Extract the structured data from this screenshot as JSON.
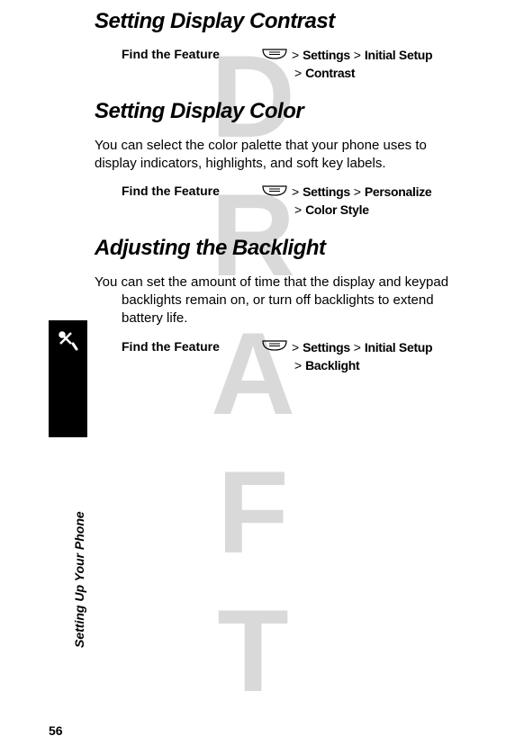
{
  "watermark": "DRAFT",
  "page_number": "56",
  "sidebar_label": "Setting Up Your Phone",
  "sections": {
    "contrast": {
      "title": "Setting Display Contrast",
      "find_label": "Find the Feature",
      "path1_gt1": "> ",
      "path1_item1": "Settings",
      "path1_gt2": " > ",
      "path1_item2": "Initial Setup",
      "path2_gt": "> ",
      "path2_item": "Contrast"
    },
    "color": {
      "title": "Setting Display Color",
      "body": "You can select the color palette that your phone uses to display indicators, highlights, and soft key labels.",
      "find_label": "Find the Feature",
      "path1_gt1": "> ",
      "path1_item1": "Settings",
      "path1_gt2": " > ",
      "path1_item2": "Personalize",
      "path2_gt": "> ",
      "path2_item": "Color Style"
    },
    "backlight": {
      "title": "Adjusting the Backlight",
      "body": "You can set the amount of time that the display and keypad backlights remain on, or turn off backlights to extend battery life.",
      "find_label": "Find the Feature",
      "path1_gt1": "> ",
      "path1_item1": "Settings",
      "path1_gt2": " > ",
      "path1_item2": "Initial Setup",
      "path2_gt": "> ",
      "path2_item": "Backlight"
    }
  }
}
